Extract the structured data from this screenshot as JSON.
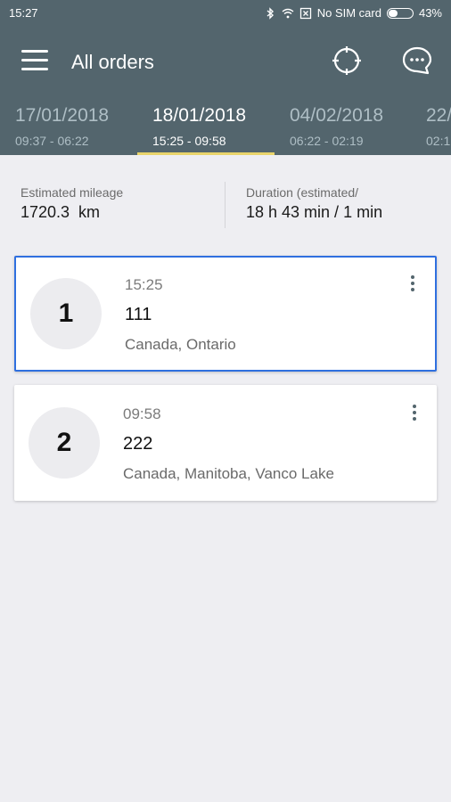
{
  "status_bar": {
    "time": "15:27",
    "sim": "No SIM card",
    "battery": "43%",
    "battery_level": 0.43
  },
  "header": {
    "title": "All orders",
    "icons": [
      "menu-icon",
      "crosshair-icon",
      "chat-icon"
    ]
  },
  "tabs": [
    {
      "date": "17/01/2018",
      "range": "09:37 - 06:22"
    },
    {
      "date": "18/01/2018",
      "range": "15:25 - 09:58"
    },
    {
      "date": "04/02/2018",
      "range": "06:22 - 02:19"
    },
    {
      "date": "22/",
      "range": "02:1"
    }
  ],
  "active_tab": 1,
  "stats": {
    "mileage_label": "Estimated mileage",
    "mileage_value": "1720.3  km",
    "duration_label": "Duration (estimated/",
    "duration_value": "18 h 43 min / 1 min"
  },
  "orders": [
    {
      "number": "1",
      "time": "15:25",
      "name": "111",
      "address": "Canada, Ontario",
      "selected": true
    },
    {
      "number": "2",
      "time": "09:58",
      "name": "222",
      "address": "Canada, Manitoba, Vanco Lake",
      "selected": false
    }
  ],
  "colors": {
    "toolbar": "#53656d",
    "accent_underline": "#e9d46b",
    "selection_border": "#2f6fdf",
    "background": "#eeeef2"
  }
}
